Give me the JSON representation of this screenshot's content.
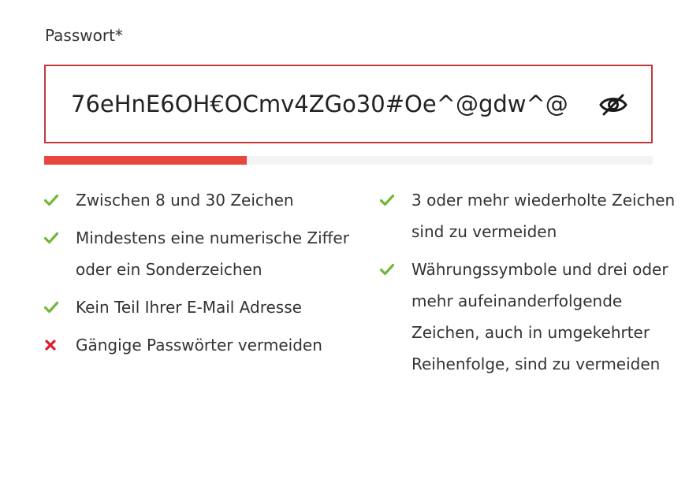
{
  "field": {
    "label": "Passwort*",
    "value": "76eHnE6OH€OCmv4ZGo30#Oe^@gdw^@",
    "toggle_icon": "eye-slash-icon"
  },
  "strength": {
    "level_fraction": 0.333,
    "fill_color": "#e8463c",
    "track_color": "#f3f3f3"
  },
  "colors": {
    "border_error": "#c1393b",
    "check": "#72b63a",
    "cross": "#d8202e",
    "text": "#333333"
  },
  "rules_left": [
    {
      "text": "Zwischen 8 und 30 Zeichen",
      "status": "ok",
      "icon": "check-icon"
    },
    {
      "text": "Mindestens eine numerische Ziffer oder ein Sonderzeichen",
      "status": "ok",
      "icon": "check-icon"
    },
    {
      "text": "Kein Teil Ihrer E-Mail Adresse",
      "status": "ok",
      "icon": "check-icon"
    },
    {
      "text": "Gängige Passwörter vermeiden",
      "status": "fail",
      "icon": "cross-icon"
    }
  ],
  "rules_right": [
    {
      "text": "3 oder mehr wiederholte Zeichen sind zu vermeiden",
      "status": "ok",
      "icon": "check-icon"
    },
    {
      "text": "Währungssymbole und drei oder mehr aufeinanderfolgende Zeichen, auch in umgekehrter Reihenfolge, sind zu vermeiden",
      "status": "ok",
      "icon": "check-icon"
    }
  ]
}
